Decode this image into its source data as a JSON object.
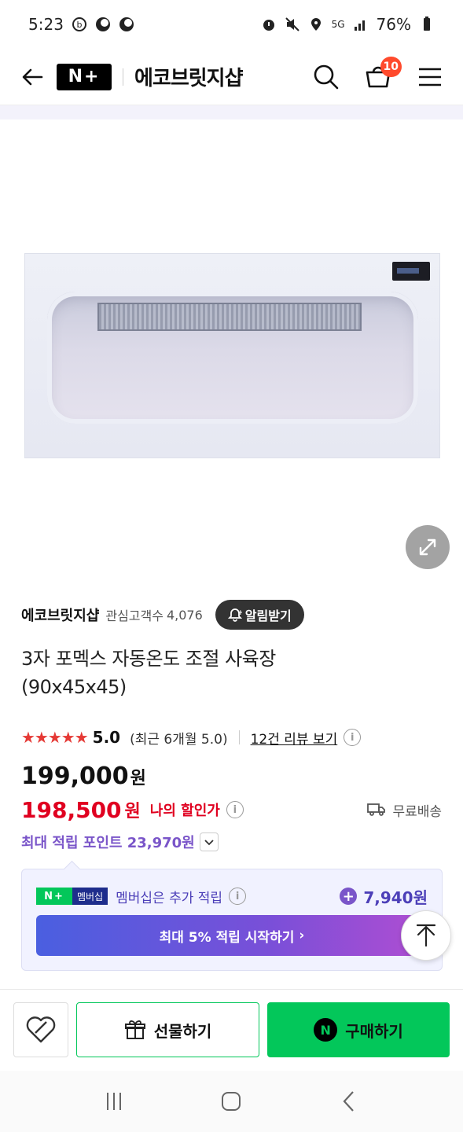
{
  "status_bar": {
    "time": "5:23",
    "battery": "76%",
    "network": "5G"
  },
  "header": {
    "logo_text": "N+",
    "store_name": "에코브릿지샵",
    "cart_count": "10"
  },
  "seller": {
    "name": "에코브릿지샵",
    "fav_label": "관심고객수",
    "fav_count": "4,076",
    "alarm_label": "알림받기"
  },
  "product": {
    "title_line1": "3자 포멕스 자동온도 조절 사육장",
    "title_line2": "(90x45x45)"
  },
  "rating": {
    "stars": "★★★★★",
    "score": "5.0",
    "recent": "(최근 6개월 5.0)",
    "review_link": "12건 리뷰 보기"
  },
  "price": {
    "original": "199,000",
    "original_unit": "원",
    "sale": "198,500",
    "sale_unit": "원",
    "sale_label": "나의 할인가",
    "shipping": "무료배송"
  },
  "points": {
    "label": "최대 적립 포인트 23,970원"
  },
  "membership": {
    "logo": "N+",
    "badge_text": "멤버십",
    "desc": "멤버십은 추가 적립",
    "points": "7,940원",
    "cta": "최대 5% 적립 시작하기",
    "cta_arrow": "›"
  },
  "actions": {
    "gift_label": "선물하기",
    "buy_label": "구매하기",
    "buy_badge": "N"
  },
  "colors": {
    "accent_green": "#03c75a",
    "sale_red": "#e00020",
    "point_purple": "#7a55c9",
    "badge_orange": "#ff4a2c"
  },
  "icons": {
    "back": "arrow-left-icon",
    "search": "search-icon",
    "cart": "cart-icon",
    "menu": "hamburger-menu-icon",
    "zoom": "expand-icon",
    "bell": "bell-icon",
    "info": "info-icon",
    "truck": "truck-icon",
    "chevron": "chevron-down-icon",
    "wish": "heart-icon",
    "gift": "gift-icon",
    "scroll_top": "arrow-up-icon"
  }
}
